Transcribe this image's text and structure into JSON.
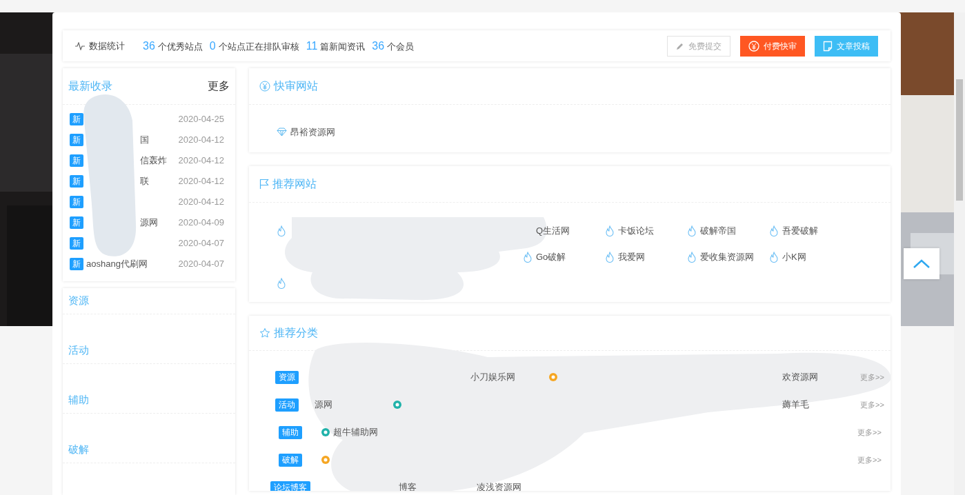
{
  "stats": {
    "label": "数据统计",
    "items": [
      {
        "value": "36",
        "text": "个优秀站点"
      },
      {
        "value": "0",
        "text": "个站点正在排队审核"
      },
      {
        "value": "11",
        "text": "篇新闻资讯"
      },
      {
        "value": "36",
        "text": "个会员"
      }
    ]
  },
  "actions": [
    {
      "label": "免费提交",
      "kind": "plain"
    },
    {
      "label": "付费快审",
      "kind": "paid"
    },
    {
      "label": "文章投稿",
      "kind": "post"
    }
  ],
  "latest": {
    "title": "最新收录",
    "more": "更多",
    "items": [
      {
        "badge": "新",
        "date": "2020-04-25"
      },
      {
        "badge": "新",
        "name": "国",
        "date": "2020-04-12"
      },
      {
        "badge": "新",
        "name": "信轰炸",
        "date": "2020-04-12"
      },
      {
        "badge": "新",
        "name": "联",
        "date": "2020-04-12"
      },
      {
        "badge": "新",
        "date": "2020-04-12"
      },
      {
        "badge": "新",
        "name": "源网",
        "date": "2020-04-09"
      },
      {
        "badge": "新",
        "date": "2020-04-07"
      },
      {
        "badge": "新",
        "name": "aoshang代刷网",
        "full": true,
        "date": "2020-04-07"
      }
    ]
  },
  "category_nav": [
    "资源",
    "活动",
    "辅助",
    "破解"
  ],
  "fast_review": {
    "title": "快审网站",
    "sites": [
      "昂裕资源网"
    ]
  },
  "recommended": {
    "title": "推荐网站",
    "rows": [
      [
        {
          "kind": "icon_only"
        },
        {
          "kind": "redacted"
        },
        {
          "kind": "redacted"
        },
        {
          "kind": "text_only",
          "name": "Q生活网"
        },
        {
          "kind": "site",
          "name": "卡饭论坛"
        },
        {
          "kind": "site",
          "name": "破解帝国"
        },
        {
          "kind": "site",
          "name": "吾爱破解"
        }
      ],
      [
        {
          "kind": "redacted"
        },
        {
          "kind": "redacted"
        },
        {
          "kind": "redacted"
        },
        {
          "kind": "site",
          "name": "Go破解"
        },
        {
          "kind": "site",
          "name": "我爱网"
        },
        {
          "kind": "site",
          "name": "爱收集资源网"
        },
        {
          "kind": "site",
          "name": "小K网"
        }
      ],
      [
        {
          "kind": "icon_only"
        }
      ]
    ]
  },
  "categories": {
    "title": "推荐分类",
    "rows": [
      {
        "tag": "资源",
        "more": "更多>>",
        "items": [
          {
            "kind": "redacted"
          },
          {
            "kind": "redacted"
          },
          {
            "kind": "text_only",
            "name": "小刀娱乐网"
          },
          {
            "kind": "icon_only"
          },
          {
            "kind": "redacted"
          },
          {
            "kind": "redacted"
          },
          {
            "kind": "text_only",
            "name": "欢资源网"
          }
        ]
      },
      {
        "tag": "活动",
        "more": "更多>>",
        "items": [
          {
            "kind": "text_only",
            "name": "源网"
          },
          {
            "kind": "icon_only"
          },
          {
            "kind": "redacted"
          },
          {
            "kind": "redacted"
          },
          {
            "kind": "redacted"
          },
          {
            "kind": "redacted"
          },
          {
            "kind": "text_only",
            "name": "薅羊毛"
          }
        ]
      },
      {
        "tag": "辅助",
        "more": "更多>>",
        "items": [
          {
            "kind": "site",
            "name": "超牛辅助网"
          }
        ]
      },
      {
        "tag": "破解",
        "more": "更多>>",
        "items": [
          {
            "kind": "icon_only"
          }
        ]
      },
      {
        "tag": "论坛博客",
        "items": [
          {
            "kind": "redacted"
          },
          {
            "kind": "text_only",
            "name": "博客"
          },
          {
            "kind": "text_only",
            "name": "凌浅资源网"
          }
        ]
      }
    ]
  }
}
